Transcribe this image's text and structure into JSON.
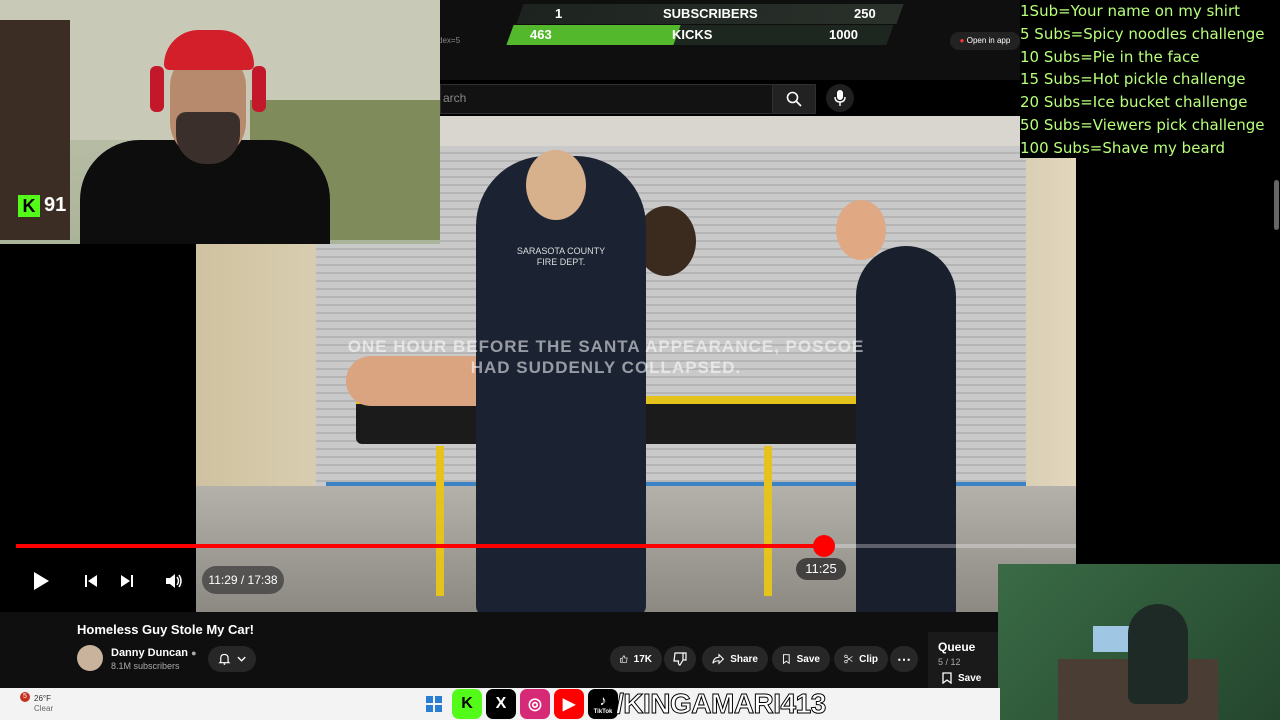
{
  "stream": {
    "kick_viewers": "91",
    "kick_logo": "K",
    "social_handle": "/KINGAMARI413",
    "socials": [
      {
        "name": "kick",
        "glyph": "K",
        "color": "#53fc18"
      },
      {
        "name": "x",
        "glyph": "X",
        "color": "#000000"
      },
      {
        "name": "instagram",
        "glyph": "◎",
        "color": "#d62976"
      },
      {
        "name": "youtube",
        "glyph": "▶",
        "color": "#ff0000"
      },
      {
        "name": "tiktok",
        "glyph": "♪",
        "color": "#000000"
      }
    ],
    "tiktok_label": "TikTok"
  },
  "goal_bar": {
    "subscribers_current": "1",
    "subscribers_label": "SUBSCRIBERS",
    "subscribers_target": "250",
    "kicks_current": "463",
    "kicks_label": "KICKS",
    "kicks_target": "1000",
    "kicks_progress": 0.463
  },
  "sub_goals": [
    "1Sub=Your name on my shirt",
    "5 Subs=Spicy noodles challenge",
    "10 Subs=Pie in the face",
    "15 Subs=Hot pickle challenge",
    "20 Subs=Ice bucket challenge",
    "50 Subs=Viewers pick challenge",
    "100 Subs=Shave my beard"
  ],
  "browser": {
    "open_in_app": "Open in app",
    "url_fragment": "dex=5",
    "search_placeholder": "arch"
  },
  "video": {
    "caption": "ONE HOUR BEFORE THE SANTA APPEARANCE, POSCOE HAD SUDDENLY COLLAPSED.",
    "current_time_display": "11:29 / 17:38",
    "hover_time": "11:25",
    "progress": 0.652,
    "jacket_text": "SARASOTA COUNTY FIRE DEPT."
  },
  "video_info": {
    "title": "Homeless Guy Stole My Car!",
    "channel": "Danny Duncan",
    "subscribers": "8.1M subscribers",
    "likes": "17K",
    "share_label": "Share",
    "save_label": "Save",
    "clip_label": "Clip"
  },
  "queue": {
    "title": "Queue",
    "count": "5 / 12",
    "save_label": "Save"
  },
  "taskbar": {
    "weather_temp": "26°F",
    "weather_desc": "Clear",
    "weather_badge": "5"
  }
}
